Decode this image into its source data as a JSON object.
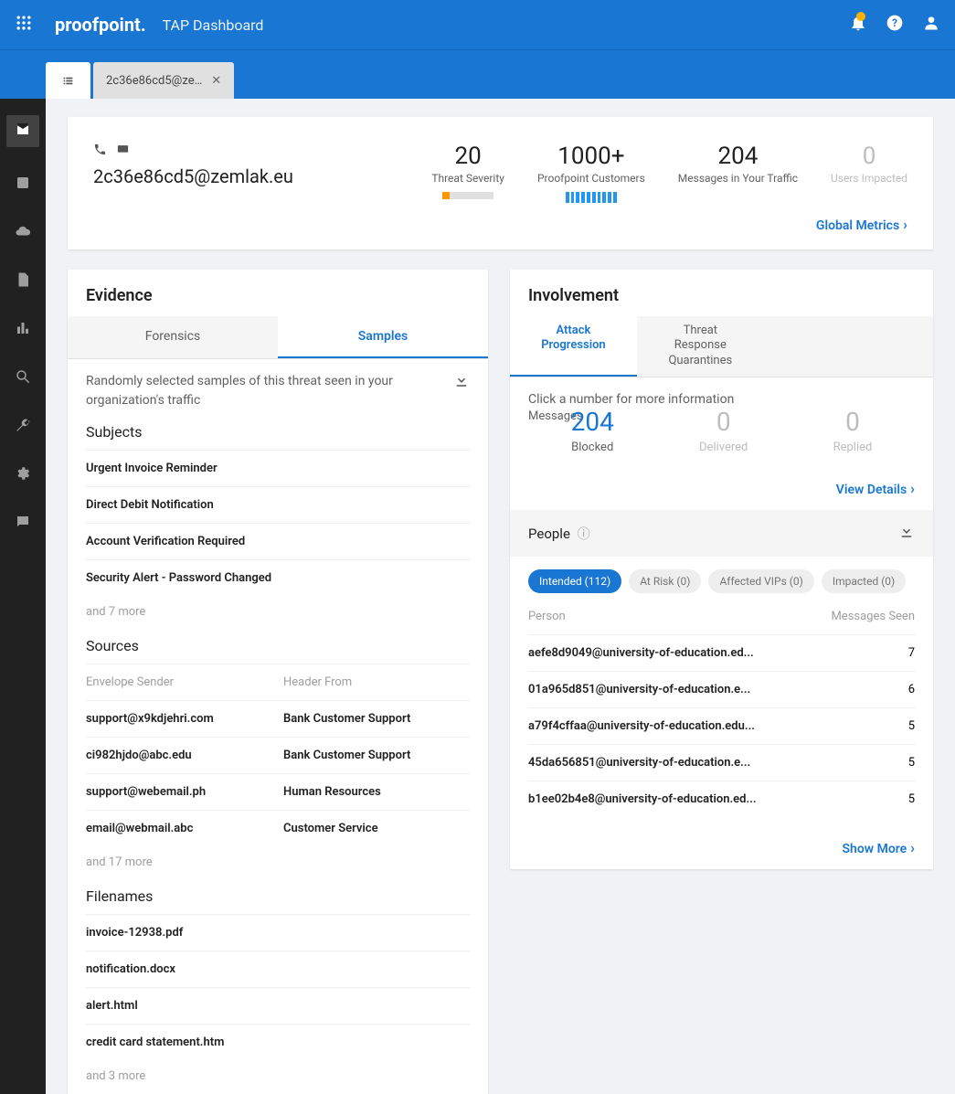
{
  "header": {
    "brand": "proofpoint.",
    "page_title": "TAP Dashboard"
  },
  "tab": {
    "label": "2c36e86cd5@ze…"
  },
  "summary": {
    "threat_id": "2c36e86cd5@zemlak.eu",
    "metrics": [
      {
        "value": "20",
        "label": "Threat\nSeverity"
      },
      {
        "value": "1000+",
        "label": "Proofpoint\nCustomers"
      },
      {
        "value": "204",
        "label": "Messages in\nYour Traffic"
      },
      {
        "value": "0",
        "label": "Users\nImpacted"
      }
    ],
    "link": "Global Metrics"
  },
  "evidence": {
    "title": "Evidence",
    "tabs": [
      "Forensics",
      "Samples"
    ],
    "desc": "Randomly selected samples of this threat seen in your organization's traffic",
    "subjects_hdr": "Subjects",
    "subjects": [
      "Urgent Invoice Reminder",
      "Direct Debit Notification",
      "Account Verification Required",
      "Security Alert - Password Changed"
    ],
    "subjects_more": "and 7 more",
    "sources_hdr": "Sources",
    "src_cols": [
      "Envelope Sender",
      "Header From"
    ],
    "sources": [
      {
        "env": "support@x9kdjehri.com",
        "hdr": "Bank Customer Support <customers..."
      },
      {
        "env": "ci982hjdo@abc.edu",
        "hdr": "Bank Customer Support <customers..."
      },
      {
        "env": "support@webemail.ph",
        "hdr": "Human Resources <hr@company.co..."
      },
      {
        "env": "email@webmail.abc",
        "hdr": "Customer Service <customersupport..."
      }
    ],
    "sources_more": "and 17 more",
    "filenames_hdr": "Filenames",
    "filenames": [
      "invoice-12938.pdf",
      "notification.docx",
      "alert.html",
      "credit card statement.htm"
    ],
    "filenames_more": "and 3 more"
  },
  "involvement": {
    "title": "Involvement",
    "tabs": [
      "Attack\nProgression",
      "Threat\nResponse\nQuarantines"
    ],
    "hint": "Click a number for more information",
    "msgs_label": "Messages",
    "stats": [
      {
        "value": "204",
        "label": "Blocked"
      },
      {
        "value": "0",
        "label": "Delivered"
      },
      {
        "value": "0",
        "label": "Replied"
      }
    ],
    "view_details": "View Details",
    "people_hdr": "People",
    "chips": [
      "Intended (112)",
      "At Risk (0)",
      "Affected VIPs (0)",
      "Impacted (0)"
    ],
    "people_cols": [
      "Person",
      "Messages Seen"
    ],
    "people": [
      {
        "p": "aefe8d9049@university-of-education.ed...",
        "n": "7"
      },
      {
        "p": "01a965d851@university-of-education.e...",
        "n": "6"
      },
      {
        "p": "a79f4cffaa@university-of-education.edu...",
        "n": "5"
      },
      {
        "p": "45da656851@university-of-education.e...",
        "n": "5"
      },
      {
        "p": "b1ee02b4e8@university-of-education.ed...",
        "n": "5"
      }
    ],
    "show_more": "Show More"
  }
}
